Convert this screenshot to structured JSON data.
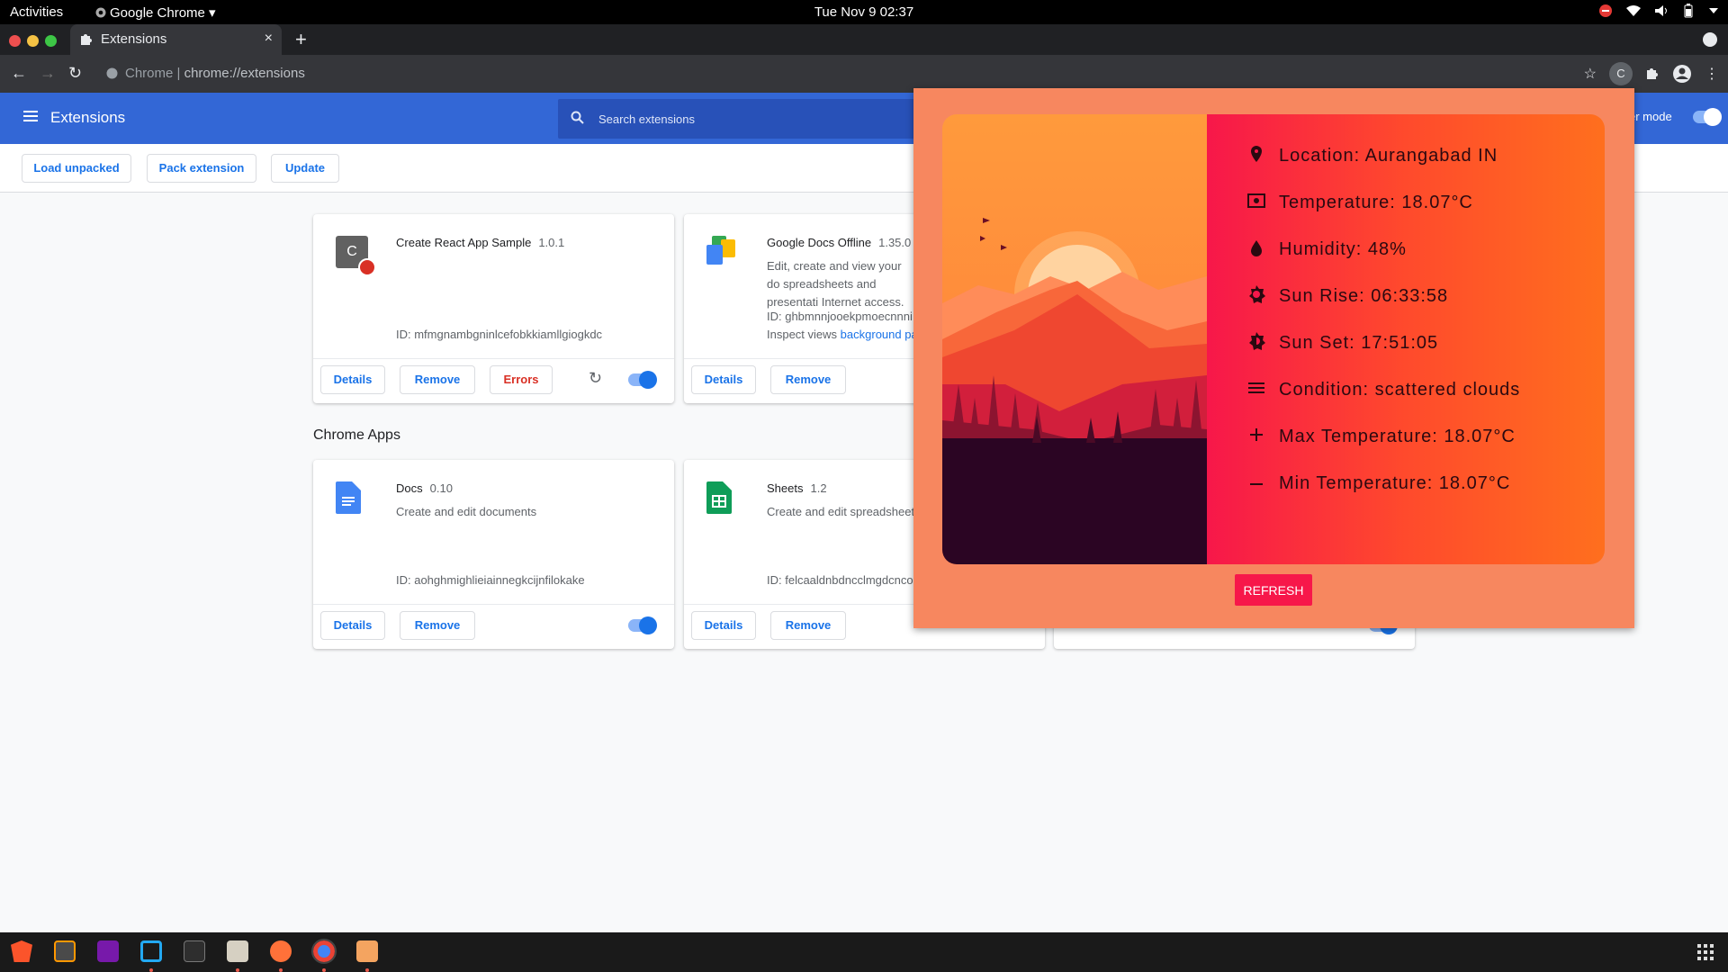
{
  "topbar": {
    "activities": "Activities",
    "app": "Google Chrome",
    "clock": "Tue Nov 9  02:37"
  },
  "tab": {
    "title": "Extensions",
    "close": "×",
    "new": "+"
  },
  "omnibox": {
    "site": "Chrome",
    "url": "chrome://extensions"
  },
  "header": {
    "title": "Extensions",
    "search_placeholder": "Search extensions",
    "dev_mode": "er mode"
  },
  "toolbar": {
    "load": "Load unpacked",
    "pack": "Pack extension",
    "update": "Update"
  },
  "extensions": [
    {
      "name": "Create React App Sample",
      "version": "1.0.1",
      "id": "ID: mfmgnambgninlcefobkkiamllgiogkdc",
      "details": "Details",
      "remove": "Remove",
      "errors": "Errors"
    },
    {
      "name": "Google Docs Offline",
      "version": "1.35.0",
      "desc": "Edit, create and view your do spreadsheets and presentati Internet access.",
      "id": "ID: ghbmnnjooekpmoecnnni",
      "inspect": "Inspect views",
      "inspect_link": "background pa",
      "details": "Details",
      "remove": "Remove"
    }
  ],
  "apps_section": "Chrome Apps",
  "apps": [
    {
      "name": "Docs",
      "version": "0.10",
      "desc": "Create and edit documents",
      "id": "ID: aohghmighlieiainnegkcijnfilokake",
      "details": "Details",
      "remove": "Remove"
    },
    {
      "name": "Sheets",
      "version": "1.2",
      "desc": "Create and edit spreadsheet",
      "id": "ID: felcaaldnbdncclmgdcnco",
      "details": "Details",
      "remove": "Remove"
    }
  ],
  "weather": {
    "location": "Location: Aurangabad IN",
    "temperature": "Temperature: 18.07°C",
    "humidity": "Humidity: 48%",
    "sunrise": "Sun Rise: 06:33:58",
    "sunset": "Sun Set: 17:51:05",
    "condition": "Condition: scattered clouds",
    "max": "Max Temperature: 18.07°C",
    "min": "Min Temperature: 18.07°C",
    "refresh": "REFRESH"
  },
  "colors": {
    "accent": "#3367d6",
    "popup_bg": "#f7875f",
    "refresh": "#f7174a"
  },
  "icons": [
    "pin-icon",
    "thermometer-icon",
    "drop-icon",
    "sun-icon",
    "sunset-icon",
    "menu-lines-icon",
    "plus-icon",
    "minus-icon"
  ]
}
